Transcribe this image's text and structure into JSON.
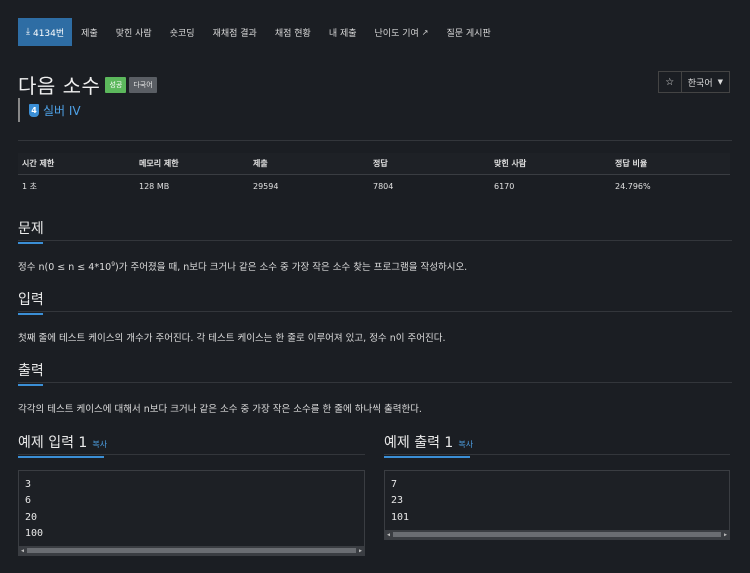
{
  "nav": {
    "problem_tab": "4134번",
    "tabs": [
      "제출",
      "맞힌 사람",
      "숏코딩",
      "재채점 결과",
      "채점 현황",
      "내 제출",
      "난이도 기여",
      "질문 게시판"
    ]
  },
  "problem": {
    "title": "다음 소수",
    "badge_success": "성공",
    "badge_lang": "다국어",
    "tier_icon_text": "4",
    "tier": "실버 IV"
  },
  "tools": {
    "star": "☆",
    "language": "한국어"
  },
  "info_table": {
    "headers": [
      "시간 제한",
      "메모리 제한",
      "제출",
      "정답",
      "맞힌 사람",
      "정답 비율"
    ],
    "row": [
      "1 초",
      "128 MB",
      "29594",
      "7804",
      "6170",
      "24.796%"
    ]
  },
  "sections": {
    "problem_heading": "문제",
    "problem_text_1": "정수 n(0 ≤ n ≤ 4*10",
    "problem_text_exp": "9",
    "problem_text_2": ")가 주어졌을 때, n보다 크거나 같은 소수 중 가장 작은 소수 찾는 프로그램을 작성하시오.",
    "input_heading": "입력",
    "input_text": "첫째 줄에 테스트 케이스의 개수가 주어진다. 각 테스트 케이스는 한 줄로 이루어져 있고, 정수 n이 주어진다.",
    "output_heading": "출력",
    "output_text": "각각의 테스트 케이스에 대해서 n보다 크거나 같은 소수 중 가장 작은 소수를 한 줄에 하나씩 출력한다."
  },
  "samples": {
    "copy_label": "복사",
    "input_heading": "예제 입력 1",
    "output_heading": "예제 출력 1",
    "input_lines": [
      "3",
      "6",
      "20",
      "100"
    ],
    "output_lines": [
      "7",
      "23",
      "101"
    ]
  },
  "colors": {
    "accent": "#2e6da4",
    "link": "#4ea1e6",
    "success": "#5cb85c",
    "background": "#1b1e23"
  },
  "icons": {
    "problem_tab": "download-icon",
    "difficulty_link": "external-link-icon",
    "tier": "silver-tier-icon"
  }
}
